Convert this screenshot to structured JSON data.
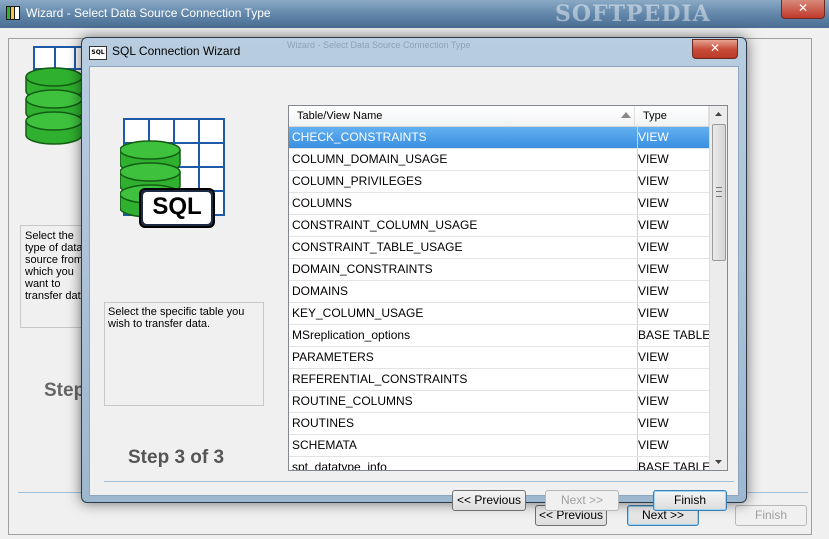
{
  "bg_window": {
    "title": "Wizard - Select Data Source Connection Type",
    "watermark": "SOFTPEDIA",
    "close_glyph": "✕",
    "description": "Select the type of data source from which you want to transfer data.",
    "step": "Step",
    "buttons": {
      "previous": "<< Previous",
      "next": "Next >>",
      "finish": "Finish"
    }
  },
  "dialog": {
    "title": "SQL Connection Wizard",
    "ghost_title": "Wizard - Select Data Source Connection Type",
    "close_glyph": "✕",
    "icon_text": "SQL",
    "title_icon_text": "SQL",
    "description": "Select the specific table you wish to transfer data.",
    "step": "Step 3 of 3",
    "buttons": {
      "previous": "<< Previous",
      "next": "Next >>",
      "finish": "Finish"
    },
    "table": {
      "columns": [
        "Table/View Name",
        "Type"
      ],
      "rows": [
        [
          "CHECK_CONSTRAINTS",
          "VIEW"
        ],
        [
          "COLUMN_DOMAIN_USAGE",
          "VIEW"
        ],
        [
          "COLUMN_PRIVILEGES",
          "VIEW"
        ],
        [
          "COLUMNS",
          "VIEW"
        ],
        [
          "CONSTRAINT_COLUMN_USAGE",
          "VIEW"
        ],
        [
          "CONSTRAINT_TABLE_USAGE",
          "VIEW"
        ],
        [
          "DOMAIN_CONSTRAINTS",
          "VIEW"
        ],
        [
          "DOMAINS",
          "VIEW"
        ],
        [
          "KEY_COLUMN_USAGE",
          "VIEW"
        ],
        [
          "MSreplication_options",
          "BASE TABLE"
        ],
        [
          "PARAMETERS",
          "VIEW"
        ],
        [
          "REFERENTIAL_CONSTRAINTS",
          "VIEW"
        ],
        [
          "ROUTINE_COLUMNS",
          "VIEW"
        ],
        [
          "ROUTINES",
          "VIEW"
        ],
        [
          "SCHEMATA",
          "VIEW"
        ],
        [
          "spt_datatype_info",
          "BASE TABLE"
        ]
      ],
      "selected_index": 0
    }
  },
  "colors": {
    "selection": "#3a8fe0",
    "db_green": "#2fb12f",
    "close_red": "#c94e3a"
  }
}
